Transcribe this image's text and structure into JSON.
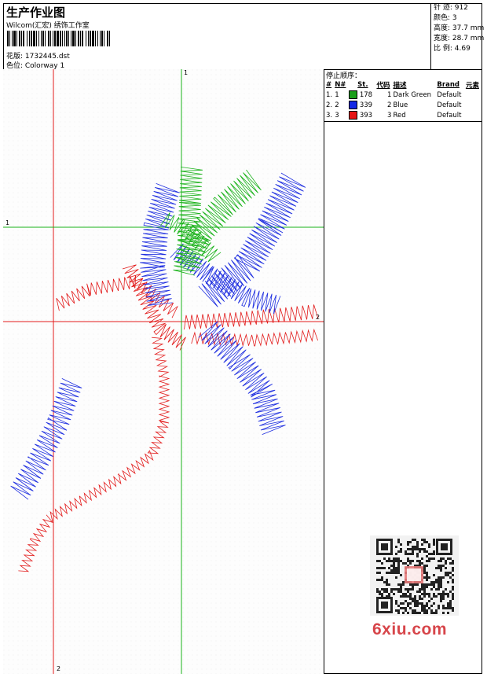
{
  "header": {
    "title": "生产作业图",
    "subtitle": "Wilcom(汇宏) 绣饰工作室",
    "design_label": "花版: 1732445.dst",
    "colorway_label": "色位: Colorway 1"
  },
  "stats": {
    "stitches": "针 迹: 912",
    "colors": "颜色: 3",
    "height": "高度: 37.7 mm",
    "width": "宽度: 28.7 mm",
    "scale": "比 例: 4.69"
  },
  "stop_sequence": {
    "title": "停止顺序：",
    "headers": [
      "#",
      "N#",
      "St.",
      "代码",
      "描述",
      "Brand",
      "元素"
    ],
    "rows": [
      {
        "index": "1.",
        "needle": "1",
        "color": "#1a9e1a",
        "stitches": "178",
        "code": "1",
        "description": "Dark Green",
        "brand": "Default"
      },
      {
        "index": "2.",
        "needle": "2",
        "color": "#1428e6",
        "stitches": "339",
        "code": "2",
        "description": "Blue",
        "brand": "Default"
      },
      {
        "index": "3.",
        "needle": "3",
        "color": "#e61414",
        "stitches": "393",
        "code": "3",
        "description": "Red",
        "brand": "Default"
      }
    ]
  },
  "guides": {
    "vertical_green_label": "1",
    "horizontal_green_label": "1",
    "vertical_red_label": "2",
    "horizontal_red_label": "2"
  },
  "watermark": "6xiu.com",
  "accent_colors": {
    "green": "#19b219",
    "blue": "#1e2ee0",
    "red": "#e21b1b"
  }
}
